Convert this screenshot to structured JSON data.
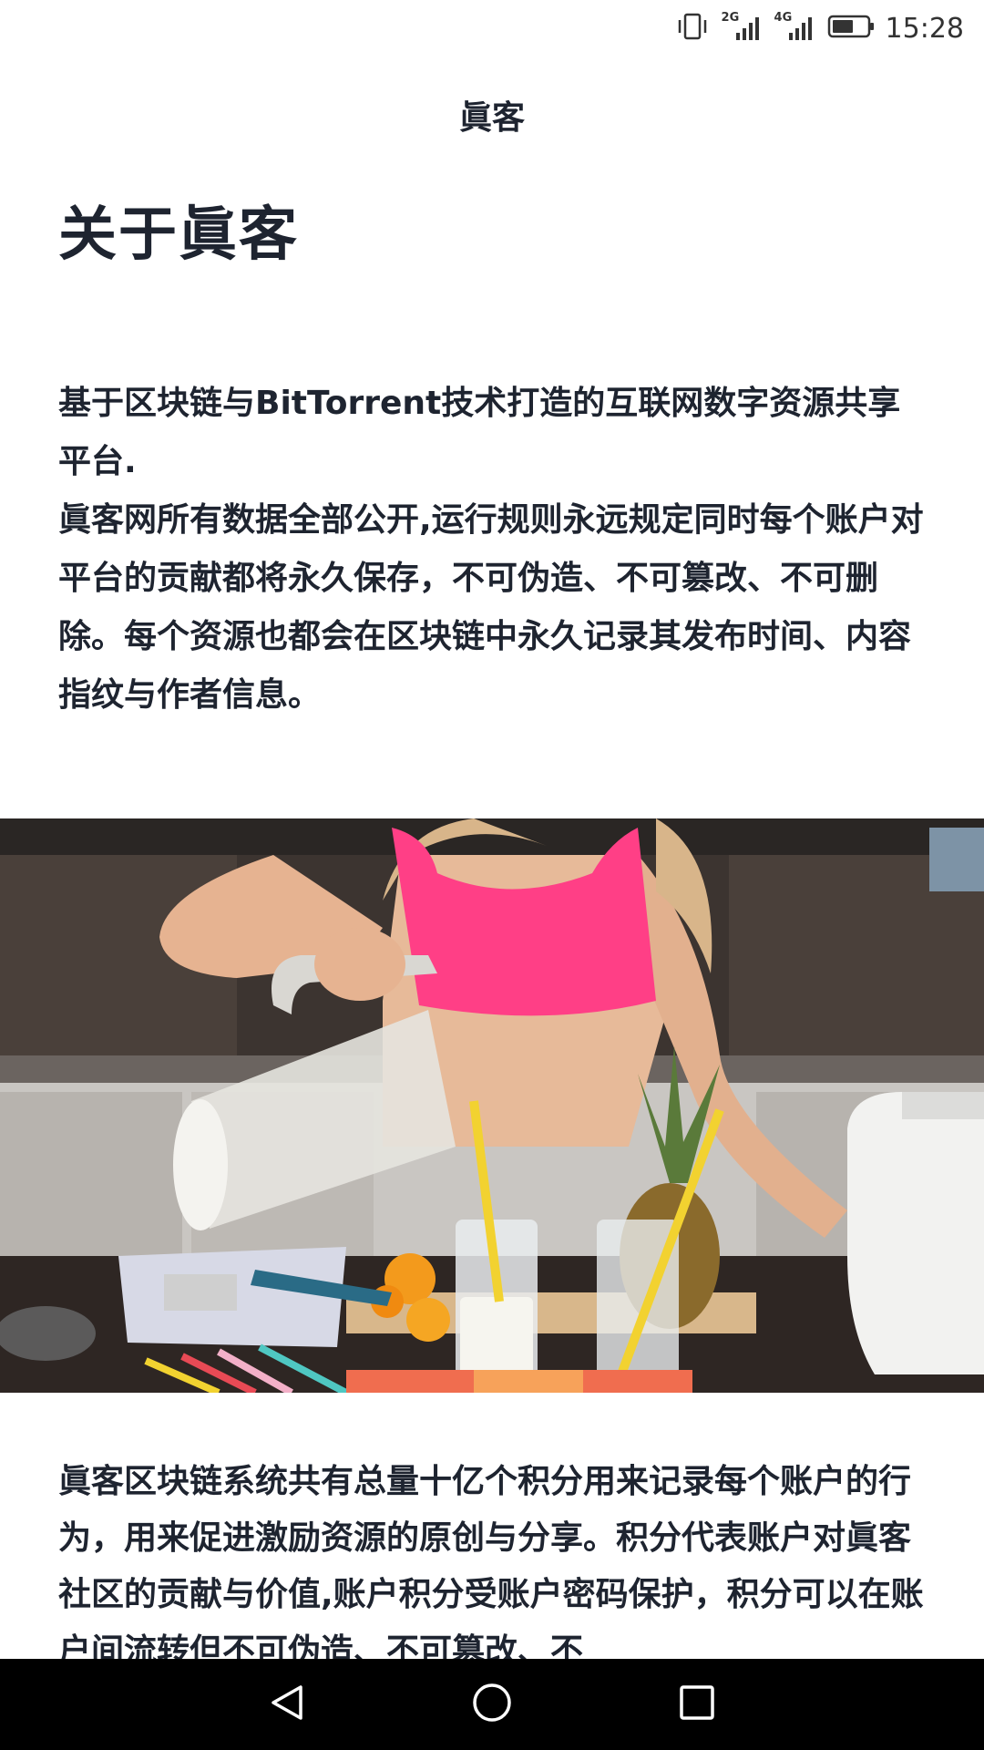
{
  "status_bar": {
    "network_2g": "2G",
    "network_4g": "4G",
    "time": "15:28",
    "icons": [
      "vibrate-icon",
      "signal-2g-icon",
      "signal-4g-icon",
      "battery-icon"
    ]
  },
  "header": {
    "title": "眞客"
  },
  "main": {
    "heading": "关于眞客",
    "intro_line_1": "基于区块链与BitTorrent技术打造的互联网数字资源共享平台.",
    "intro_line_2": "眞客网所有数据全部公开,运行规则永远规定同时每个账户对平台的贡献都将永久保存，不可伪造、不可篡改、不可删除。每个资源也都会在区块链中永久记录其发布时间、内容指纹与作者信息。",
    "hero_image": "woman-pouring-smoothie-photo",
    "body_paragraph": "眞客区块链系统共有总量十亿个积分用来记录每个账户的行为，用来促进激励资源的原创与分享。积分代表账户对眞客社区的贡献与价值,账户积分受账户密码保护，积分可以在账户间流转但不可伪造、不可篡改、不"
  },
  "nav_bar": {
    "icons": [
      "back-icon",
      "home-icon",
      "recents-icon"
    ]
  },
  "colors": {
    "text": "#1e2430",
    "nav_background": "#000000",
    "shirt_pink": "#ff3f86",
    "straw_yellow": "#f2d230"
  }
}
